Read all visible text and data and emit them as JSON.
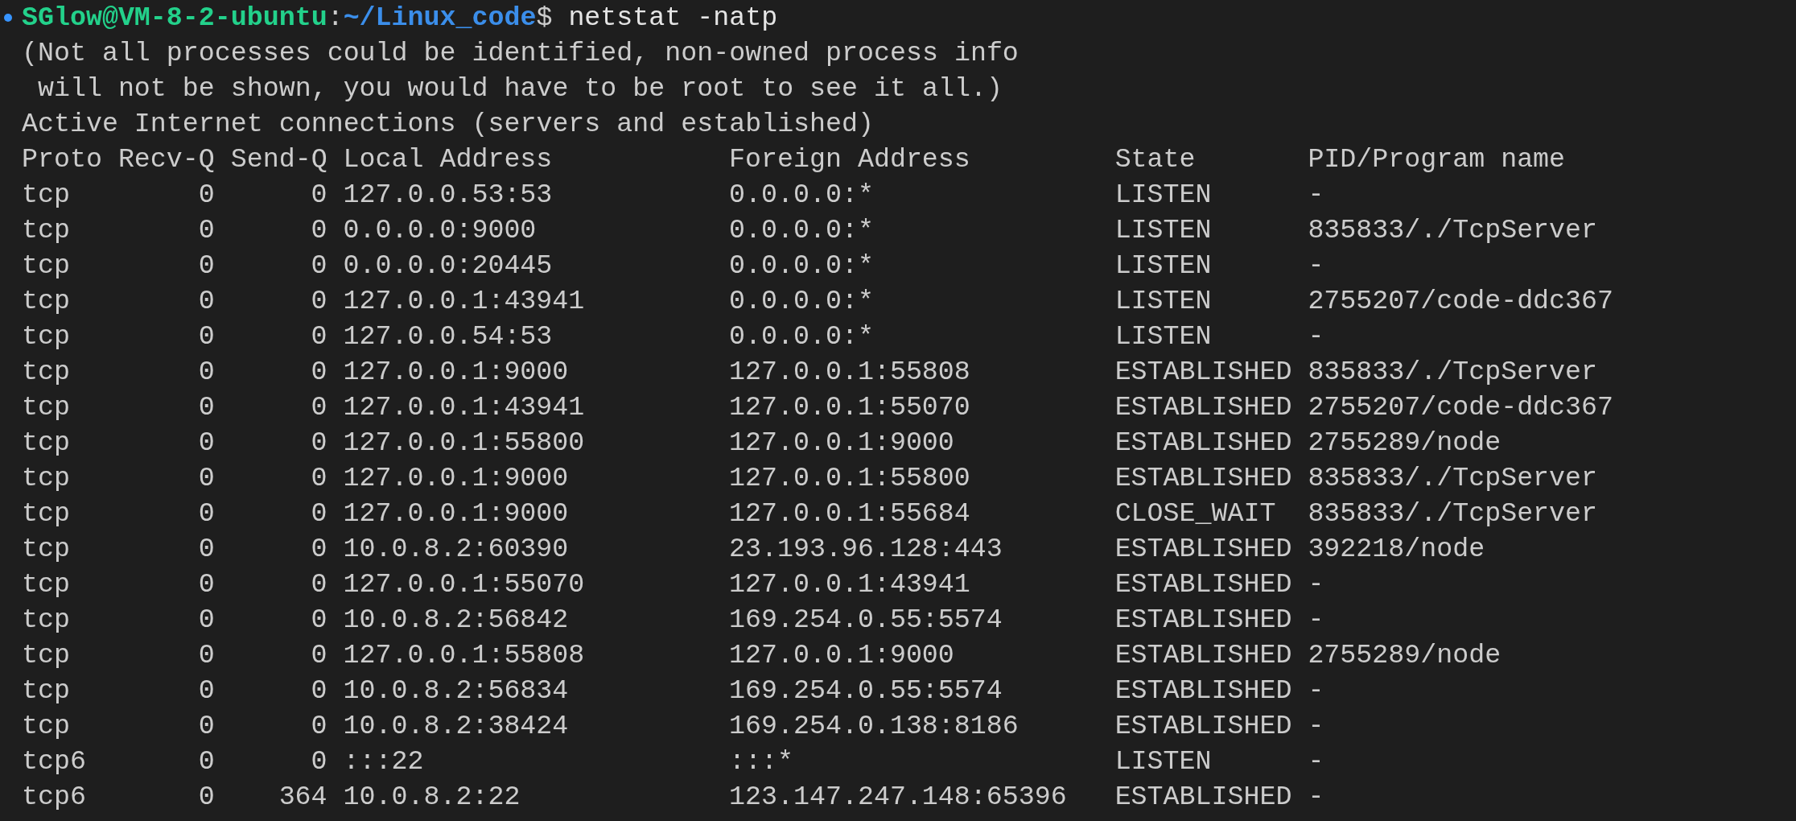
{
  "prompt": {
    "user_host": "SGlow@VM-8-2-ubuntu",
    "separator": ":",
    "path": "~/Linux_code",
    "symbol": "$",
    "command": "netstat -natp"
  },
  "messages": [
    "(Not all processes could be identified, non-owned process info",
    " will not be shown, you would have to be root to see it all.)",
    "Active Internet connections (servers and established)"
  ],
  "table": {
    "columns": [
      "Proto",
      "Recv-Q",
      "Send-Q",
      "Local Address",
      "Foreign Address",
      "State",
      "PID/Program name"
    ],
    "rows": [
      [
        "tcp",
        "0",
        "0",
        "127.0.0.53:53",
        "0.0.0.0:*",
        "LISTEN",
        "-"
      ],
      [
        "tcp",
        "0",
        "0",
        "0.0.0.0:9000",
        "0.0.0.0:*",
        "LISTEN",
        "835833/./TcpServer"
      ],
      [
        "tcp",
        "0",
        "0",
        "0.0.0.0:20445",
        "0.0.0.0:*",
        "LISTEN",
        "-"
      ],
      [
        "tcp",
        "0",
        "0",
        "127.0.0.1:43941",
        "0.0.0.0:*",
        "LISTEN",
        "2755207/code-ddc367"
      ],
      [
        "tcp",
        "0",
        "0",
        "127.0.0.54:53",
        "0.0.0.0:*",
        "LISTEN",
        "-"
      ],
      [
        "tcp",
        "0",
        "0",
        "127.0.0.1:9000",
        "127.0.0.1:55808",
        "ESTABLISHED",
        "835833/./TcpServer"
      ],
      [
        "tcp",
        "0",
        "0",
        "127.0.0.1:43941",
        "127.0.0.1:55070",
        "ESTABLISHED",
        "2755207/code-ddc367"
      ],
      [
        "tcp",
        "0",
        "0",
        "127.0.0.1:55800",
        "127.0.0.1:9000",
        "ESTABLISHED",
        "2755289/node"
      ],
      [
        "tcp",
        "0",
        "0",
        "127.0.0.1:9000",
        "127.0.0.1:55800",
        "ESTABLISHED",
        "835833/./TcpServer"
      ],
      [
        "tcp",
        "0",
        "0",
        "127.0.0.1:9000",
        "127.0.0.1:55684",
        "CLOSE_WAIT",
        "835833/./TcpServer"
      ],
      [
        "tcp",
        "0",
        "0",
        "10.0.8.2:60390",
        "23.193.96.128:443",
        "ESTABLISHED",
        "392218/node"
      ],
      [
        "tcp",
        "0",
        "0",
        "127.0.0.1:55070",
        "127.0.0.1:43941",
        "ESTABLISHED",
        "-"
      ],
      [
        "tcp",
        "0",
        "0",
        "10.0.8.2:56842",
        "169.254.0.55:5574",
        "ESTABLISHED",
        "-"
      ],
      [
        "tcp",
        "0",
        "0",
        "127.0.0.1:55808",
        "127.0.0.1:9000",
        "ESTABLISHED",
        "2755289/node"
      ],
      [
        "tcp",
        "0",
        "0",
        "10.0.8.2:56834",
        "169.254.0.55:5574",
        "ESTABLISHED",
        "-"
      ],
      [
        "tcp",
        "0",
        "0",
        "10.0.8.2:38424",
        "169.254.0.138:8186",
        "ESTABLISHED",
        "-"
      ],
      [
        "tcp6",
        "0",
        "0",
        ":::22",
        ":::*",
        "LISTEN",
        "-"
      ],
      [
        "tcp6",
        "0",
        "364",
        "10.0.8.2:22",
        "123.147.247.148:65396",
        "ESTABLISHED",
        "-"
      ]
    ]
  }
}
